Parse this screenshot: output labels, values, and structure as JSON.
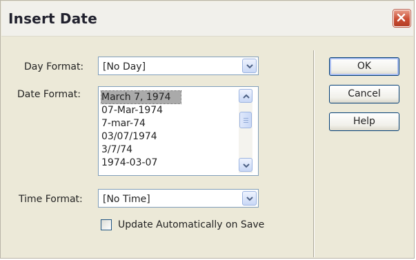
{
  "dialog": {
    "title": "Insert Date"
  },
  "day_format": {
    "label": "Day Format:",
    "selected": "[No Day]"
  },
  "date_format": {
    "label": "Date Format:",
    "options": [
      "March 7, 1974",
      "07-Mar-1974",
      "7-mar-74",
      "03/07/1974",
      "3/7/74",
      "1974-03-07"
    ],
    "selected": "March 7, 1974"
  },
  "time_format": {
    "label": "Time Format:",
    "selected": "[No Time]"
  },
  "update_auto": {
    "label": "Update Automatically on Save",
    "checked": false
  },
  "buttons": {
    "ok": "OK",
    "cancel": "Cancel",
    "help": "Help"
  },
  "colors": {
    "dialog_bg": "#ece9d8",
    "close_button": "#cb4d33",
    "selection": "#aaaaaa"
  },
  "icons": [
    "close-icon",
    "chevron-down-icon",
    "chevron-up-icon"
  ]
}
